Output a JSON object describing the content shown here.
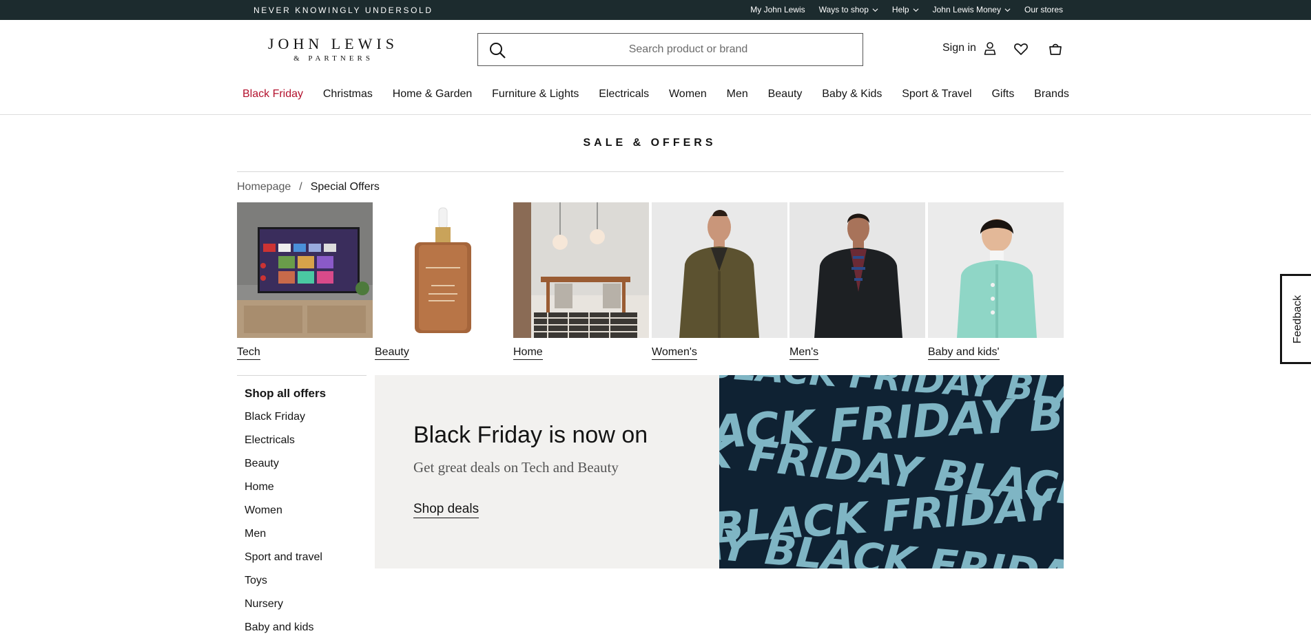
{
  "topbar": {
    "tagline": "Never knowingly undersold",
    "links": [
      {
        "label": "My John Lewis",
        "dropdown": false
      },
      {
        "label": "Ways to shop",
        "dropdown": true
      },
      {
        "label": "Help",
        "dropdown": true
      },
      {
        "label": "John Lewis Money",
        "dropdown": true
      },
      {
        "label": "Our stores",
        "dropdown": false
      }
    ]
  },
  "header": {
    "logo_line1": "JOHN LEWIS",
    "logo_line2": "& PARTNERS",
    "search_placeholder": "Search product or brand",
    "sign_in": "Sign in"
  },
  "nav": {
    "items": [
      {
        "label": "Black Friday",
        "highlight": true
      },
      {
        "label": "Christmas"
      },
      {
        "label": "Home & Garden"
      },
      {
        "label": "Furniture & Lights"
      },
      {
        "label": "Electricals"
      },
      {
        "label": "Women"
      },
      {
        "label": "Men"
      },
      {
        "label": "Beauty"
      },
      {
        "label": "Baby & Kids"
      },
      {
        "label": "Sport & Travel"
      },
      {
        "label": "Gifts"
      },
      {
        "label": "Brands"
      }
    ]
  },
  "page": {
    "title": "SALE & OFFERS",
    "breadcrumb": {
      "home": "Homepage",
      "separator": "/",
      "current": "Special Offers"
    }
  },
  "tiles": [
    {
      "label": "Tech"
    },
    {
      "label": "Beauty"
    },
    {
      "label": "Home"
    },
    {
      "label": "Women's"
    },
    {
      "label": "Men's"
    },
    {
      "label": "Baby and kids'"
    }
  ],
  "sidebar": {
    "title": "Shop all offers",
    "links": [
      "Black Friday",
      "Electricals",
      "Beauty",
      "Home",
      "Women",
      "Men",
      "Sport and travel",
      "Toys",
      "Nursery",
      "Baby and kids"
    ]
  },
  "promo": {
    "headline": "Black Friday is now on",
    "subtext": "Get great deals on Tech and Beauty",
    "cta": "Shop deals",
    "image_text": [
      "BLACK FRIDAY BLA",
      "ACK FRIDAY BLA",
      "K FRIDAY BLACK",
      "BLACK FRIDAY BLA",
      "AY BLACK FRIDAY"
    ]
  },
  "feedback": {
    "label": "Feedback"
  },
  "colors": {
    "topbar": "#1c2b2e",
    "accent_red": "#b3112d",
    "promo_bg": "#f2f1ef",
    "promo_image_bg": "#0f2233",
    "promo_image_text": "#7fb5c4"
  }
}
